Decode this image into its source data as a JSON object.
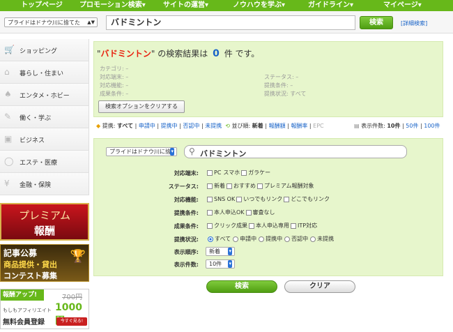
{
  "nav": [
    {
      "label": "トップページ"
    },
    {
      "label": "プロモーション検索▾"
    },
    {
      "label": "サイトの運営▾"
    },
    {
      "label": "ノウハウを学ぶ▾"
    },
    {
      "label": "ガイドライン▾"
    },
    {
      "label": "マイページ▾"
    }
  ],
  "search": {
    "site_select": "プライドはドナウ川に捨てた",
    "query": "バドミントン",
    "button": "検索",
    "advanced_link": "[詳細検索]"
  },
  "sidebar": [
    {
      "label": "ショッピング",
      "icon": "cart-icon"
    },
    {
      "label": "暮らし・住まい",
      "icon": "house-icon"
    },
    {
      "label": "エンタメ・ホビー",
      "icon": "cards-icon"
    },
    {
      "label": "働く・学ぶ",
      "icon": "desk-icon"
    },
    {
      "label": "ビジネス",
      "icon": "briefcase-icon"
    },
    {
      "label": "エステ・医療",
      "icon": "mirror-icon"
    },
    {
      "label": "金融・保険",
      "icon": "piggybank-icon"
    }
  ],
  "banners": {
    "premium_line1": "プレミアム",
    "premium_line2": "報酬",
    "contest_line1": "記事公募",
    "contest_line2": "商品提供・貸出",
    "contest_line3": "コンテスト募集",
    "signup_top": "報酬アップ!",
    "signup_old": "700円",
    "signup_sub": "もしもアフィリエイト",
    "signup_main": "無料会員登録",
    "signup_new": "1000円",
    "signup_cta": "今すぐ見る!"
  },
  "result": {
    "q_quote_open": "\"",
    "q_word": "バドミントン",
    "q_quote_close": "\"",
    "prefix": "の検索結果は",
    "count": "0",
    "suffix": "件 です。",
    "meta": [
      {
        "k": "カテゴリ:",
        "v": "–"
      },
      {
        "k": "対応端末:",
        "v": "–"
      },
      {
        "k": "対応機能:",
        "v": "–"
      },
      {
        "k": "成果条件:",
        "v": "–"
      },
      {
        "k": "ステータス:",
        "v": "–"
      },
      {
        "k": "提携条件:",
        "v": "–"
      },
      {
        "k": "提携状況:",
        "v": "すべて"
      }
    ],
    "clear_button": "検索オプションをクリアする"
  },
  "filterbar": {
    "partner_label": "提携:",
    "partner_opts": [
      "すべて",
      "申請中",
      "提携中",
      "否認中",
      "未提携"
    ],
    "sort_label": "並び順:",
    "sort_opts": [
      "新着",
      "報酬額",
      "報酬率",
      "EPC"
    ],
    "count_label": "表示件数:",
    "count_opts": [
      "10件",
      "50件",
      "100件"
    ]
  },
  "options": {
    "site_select": "プライドはドナウ川に捨",
    "query": "バドミントン",
    "rows": [
      {
        "label": "対応端末:",
        "type": "cb",
        "opts": [
          "PC",
          "スマホ",
          "ガラケー"
        ]
      },
      {
        "label": "ステータス:",
        "type": "cb",
        "opts": [
          "新着",
          "おすすめ",
          "プレミアム報酬対象"
        ]
      },
      {
        "label": "対応機能:",
        "type": "cb",
        "opts": [
          "SNS OK",
          "いつでもリンク",
          "どこでもリンク"
        ]
      },
      {
        "label": "提携条件:",
        "type": "cb",
        "opts": [
          "本人申込OK",
          "審査なし"
        ]
      },
      {
        "label": "成果条件:",
        "type": "cb",
        "opts": [
          "クリック成果",
          "本人申込専用",
          "ITP対応"
        ]
      },
      {
        "label": "提携状況:",
        "type": "rb",
        "opts": [
          "すべて",
          "申請中",
          "提携中",
          "否認中",
          "未提携"
        ]
      }
    ],
    "order_label": "表示順序:",
    "order_value": "新着",
    "count_label": "表示件数:",
    "count_value": "10件",
    "search_button": "検索",
    "clear_button": "クリア"
  },
  "colors": {
    "brand_green": "#67b81a",
    "panel_green": "#e7f6cc",
    "link_blue": "#1a64c8",
    "highlight_red": "#e8200e"
  }
}
